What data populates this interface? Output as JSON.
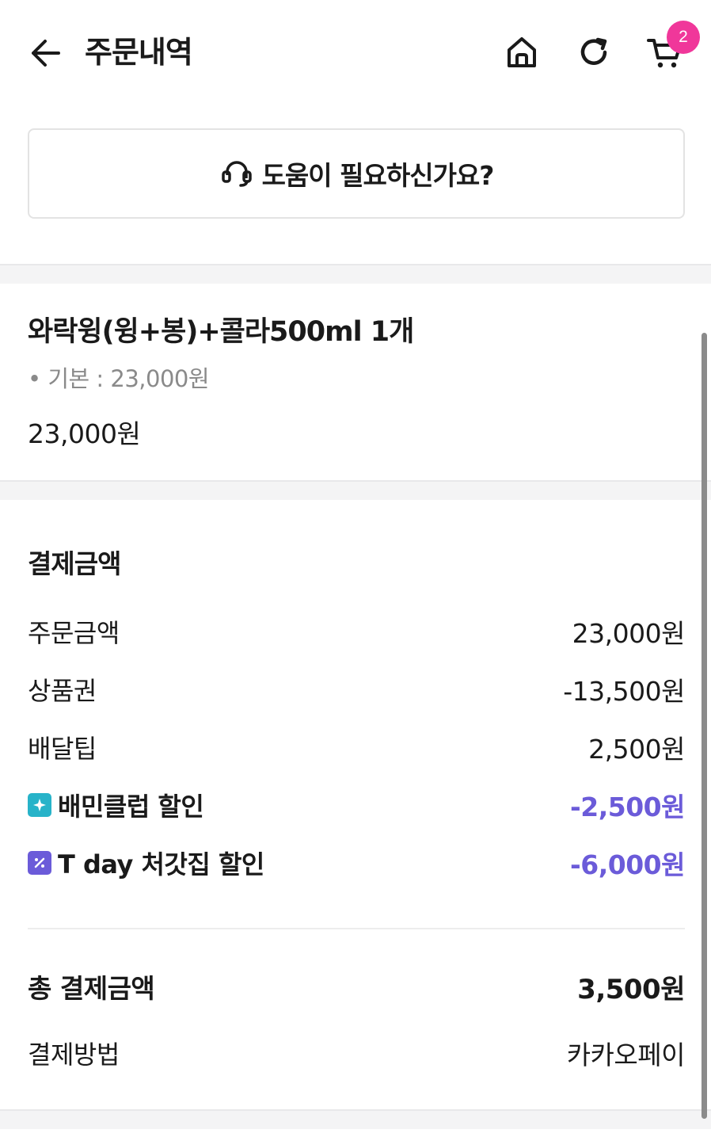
{
  "header": {
    "title": "주문내역",
    "cart_count": "2"
  },
  "help": {
    "label": "도움이 필요하신가요?"
  },
  "order_item": {
    "name": "와락윙(윙+봉)+콜라500ml 1개",
    "option": "• 기본 : 23,000원",
    "price": "23,000원"
  },
  "payment": {
    "title": "결제금액",
    "rows": [
      {
        "label": "주문금액",
        "value": "23,000원"
      },
      {
        "label": "상품권",
        "value": "-13,500원"
      },
      {
        "label": "배달팁",
        "value": "2,500원"
      },
      {
        "label": "배민클럽 할인",
        "value": "-2,500원"
      },
      {
        "label": "T day 처갓집 할인",
        "value": "-6,000원"
      }
    ],
    "total": {
      "label": "총 결제금액",
      "value": "3,500원"
    },
    "method": {
      "label": "결제방법",
      "value": "카카오페이"
    }
  },
  "colors": {
    "accent_discount": "#6b5bd9",
    "badge_pink": "#f0379a",
    "club_teal": "#27b3c9"
  }
}
